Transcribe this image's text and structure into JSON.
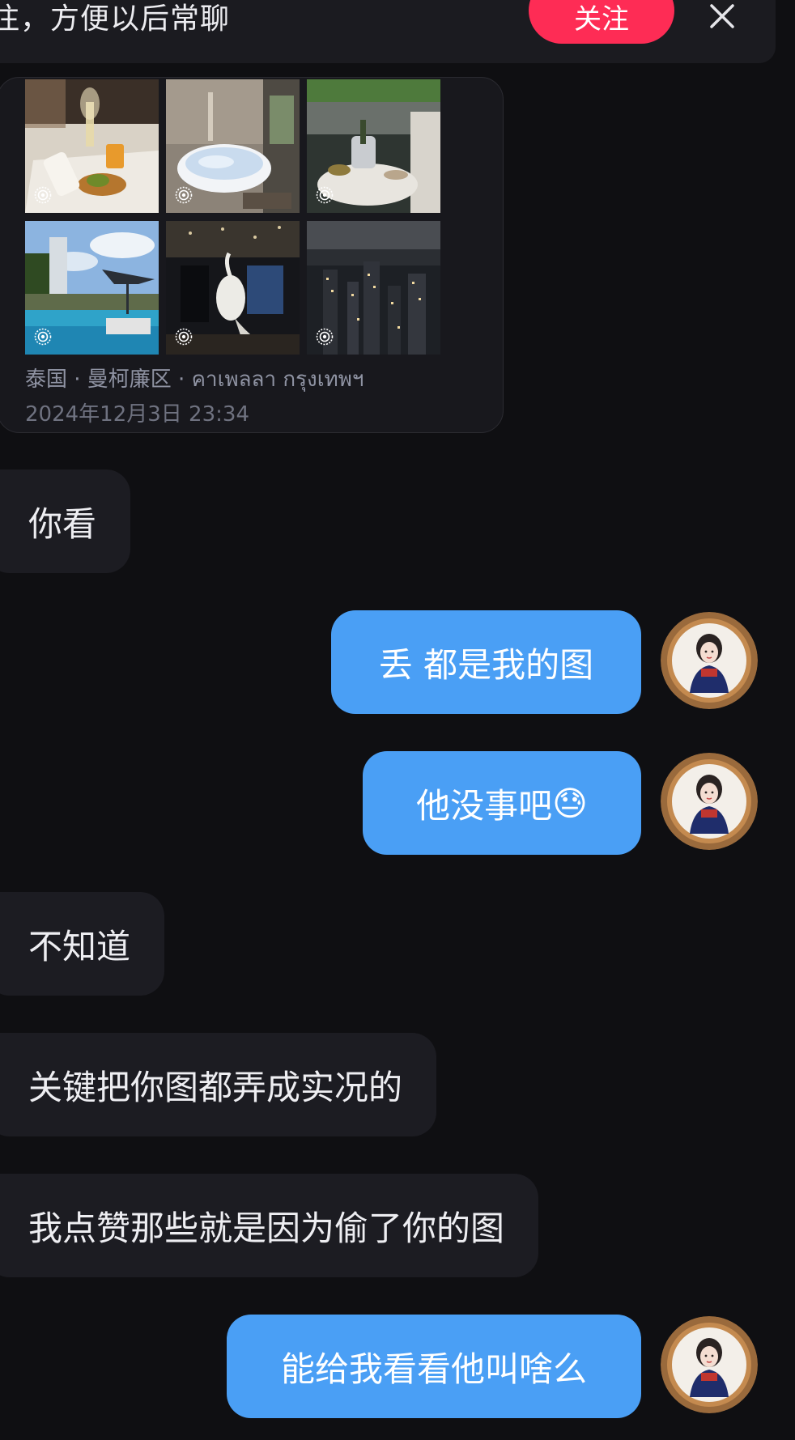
{
  "banner": {
    "text": "注，方便以后常聊",
    "follow_label": "关注",
    "close_icon": "close-icon"
  },
  "post": {
    "location": "泰国 · 曼柯廉区 · คาเพลลา กรุงเทพฯ",
    "timestamp": "2024年12月3日 23:34",
    "photo_count": 6,
    "photo_badge_icon": "live-photo-icon"
  },
  "messages": [
    {
      "side": "left",
      "text": "你看"
    },
    {
      "side": "right",
      "text": "丢 都是我的图"
    },
    {
      "side": "right",
      "text": "他没事吧",
      "emoji": "😓"
    },
    {
      "side": "left",
      "text": "不知道"
    },
    {
      "side": "left",
      "text": "关键把你图都弄成实况的"
    },
    {
      "side": "left",
      "text": "我点赞那些就是因为偷了你的图"
    },
    {
      "side": "right",
      "text": "能给我看看他叫啥么"
    }
  ],
  "colors": {
    "background": "#0f0f12",
    "incoming_bubble": "#1c1c22",
    "outgoing_bubble": "#4a9ff5",
    "follow_button": "#fe2c55"
  }
}
